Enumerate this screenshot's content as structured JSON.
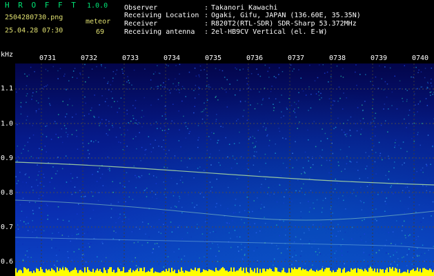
{
  "header": {
    "app_name": "H R O F F T",
    "version": "1.0.0",
    "filename": "2504280730.png",
    "datetime": "25.04.28 07:30",
    "mode_label": "meteor",
    "count": "69"
  },
  "info": [
    {
      "label": "Observer",
      "value": "Takanori Kawachi"
    },
    {
      "label": "Receiving Location",
      "value": "Ogaki, Gifu, JAPAN (136.60E, 35.35N)"
    },
    {
      "label": "Receiver",
      "value": "R820T2(RTL-SDR) SDR-Sharp 53.372MHz"
    },
    {
      "label": "Receiving antenna",
      "value": "2el-HB9CV Vertical (el. E-W)"
    }
  ],
  "axis": {
    "unit": "kHz",
    "y_ticks": [
      "1.1",
      "1.0",
      "0.9",
      "0.8",
      "0.7",
      "0.6"
    ],
    "x_ticks": [
      "0731",
      "0732",
      "0733",
      "0734",
      "0735",
      "0736",
      "0737",
      "0738",
      "0739",
      "0740"
    ]
  },
  "colors": {
    "background": "#000000",
    "grid": "#4a4a4a",
    "trace": "#b0e0a0",
    "baseline": "#ffff00"
  }
}
